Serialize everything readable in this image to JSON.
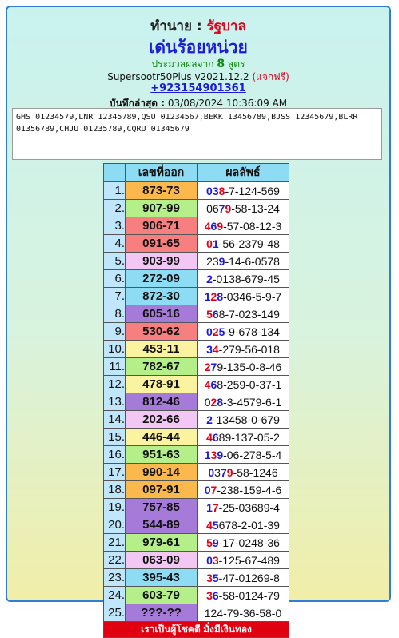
{
  "header": {
    "forecast_label": "ทำนาย :",
    "forecast_value": "รัฐบาล",
    "title": "เด่นร้อยหน่วย",
    "calc_prefix": "ประมวลผลจาก",
    "calc_count": "8",
    "calc_suffix": "สูตร",
    "version": "Supersootr50Plus v2021.12.2",
    "free_note": "(แจกฟรี)",
    "phone": "+923154901361",
    "saved_label": "บันทึกล่าสุด :",
    "saved_value": "03/08/2024 10:36:09 AM"
  },
  "notes": {
    "text": "GHS 01234579,LNR 12345789,QSU 01234567,BEKK 13456789,BJSS 12345679,BLRR 01356789,CHJU 01235789,CQRU 01345679"
  },
  "table": {
    "headers": [
      "",
      "เลขที่ออก",
      "ผลลัพธ์"
    ],
    "rows": [
      {
        "idx": "1.",
        "num": "873-73",
        "bg": "orange",
        "seg": [
          [
            "b",
            "0"
          ],
          [
            "b",
            "3"
          ],
          [
            "r",
            "8"
          ],
          [
            "n",
            "-7-124-569"
          ]
        ]
      },
      {
        "idx": "2.",
        "num": "907-99",
        "bg": "green",
        "seg": [
          [
            "n",
            "06"
          ],
          [
            "b",
            "7"
          ],
          [
            "r",
            "9"
          ],
          [
            "n",
            "-58-13-24"
          ]
        ]
      },
      {
        "idx": "3.",
        "num": "906-71",
        "bg": "red",
        "seg": [
          [
            "r",
            "4"
          ],
          [
            "b",
            "6"
          ],
          [
            "r",
            "9"
          ],
          [
            "n",
            "-57-08-12-3"
          ]
        ]
      },
      {
        "idx": "4.",
        "num": "091-65",
        "bg": "red",
        "seg": [
          [
            "r",
            "0"
          ],
          [
            "b",
            "1"
          ],
          [
            "n",
            "-56-2379-48"
          ]
        ]
      },
      {
        "idx": "5.",
        "num": "903-99",
        "bg": "pink",
        "seg": [
          [
            "n",
            "23"
          ],
          [
            "b",
            "9"
          ],
          [
            "n",
            "-14-6-0578"
          ]
        ]
      },
      {
        "idx": "6.",
        "num": "272-09",
        "bg": "cyan",
        "seg": [
          [
            "b",
            "2"
          ],
          [
            "n",
            "-0138-679-45"
          ]
        ]
      },
      {
        "idx": "7.",
        "num": "872-30",
        "bg": "cyan",
        "seg": [
          [
            "b",
            "1"
          ],
          [
            "r",
            "2"
          ],
          [
            "b",
            "8"
          ],
          [
            "n",
            "-0346-5-9-7"
          ]
        ]
      },
      {
        "idx": "8.",
        "num": "605-16",
        "bg": "purple",
        "seg": [
          [
            "r",
            "5"
          ],
          [
            "b",
            "6"
          ],
          [
            "n",
            "8-7-023-149"
          ]
        ]
      },
      {
        "idx": "9.",
        "num": "530-62",
        "bg": "red",
        "seg": [
          [
            "b",
            "0"
          ],
          [
            "r",
            "2"
          ],
          [
            "b",
            "5"
          ],
          [
            "n",
            "-9-678-134"
          ]
        ]
      },
      {
        "idx": "10.",
        "num": "453-11",
        "bg": "yellow",
        "seg": [
          [
            "b",
            "3"
          ],
          [
            "r",
            "4"
          ],
          [
            "n",
            "-279-56-018"
          ]
        ]
      },
      {
        "idx": "11.",
        "num": "782-67",
        "bg": "green",
        "seg": [
          [
            "r",
            "2"
          ],
          [
            "b",
            "7"
          ],
          [
            "n",
            "9-135-0-8-46"
          ]
        ]
      },
      {
        "idx": "12.",
        "num": "478-91",
        "bg": "yellow",
        "seg": [
          [
            "r",
            "4"
          ],
          [
            "b",
            "6"
          ],
          [
            "n",
            "8-259-0-37-1"
          ]
        ]
      },
      {
        "idx": "13.",
        "num": "812-46",
        "bg": "purple",
        "seg": [
          [
            "n",
            "0"
          ],
          [
            "r",
            "2"
          ],
          [
            "b",
            "8"
          ],
          [
            "n",
            "-3-4579-6-1"
          ]
        ]
      },
      {
        "idx": "14.",
        "num": "202-66",
        "bg": "pink",
        "seg": [
          [
            "b",
            "2"
          ],
          [
            "n",
            "-13458-0-679"
          ]
        ]
      },
      {
        "idx": "15.",
        "num": "446-44",
        "bg": "yellow",
        "seg": [
          [
            "r",
            "4"
          ],
          [
            "b",
            "6"
          ],
          [
            "n",
            "89-137-05-2"
          ]
        ]
      },
      {
        "idx": "16.",
        "num": "951-63",
        "bg": "green",
        "seg": [
          [
            "b",
            "1"
          ],
          [
            "r",
            "3"
          ],
          [
            "b",
            "9"
          ],
          [
            "n",
            "-06-278-5-4"
          ]
        ]
      },
      {
        "idx": "17.",
        "num": "990-14",
        "bg": "orange",
        "seg": [
          [
            "b",
            "0"
          ],
          [
            "n",
            "3"
          ],
          [
            "b",
            "7"
          ],
          [
            "r",
            "9"
          ],
          [
            "n",
            "-58-1246"
          ]
        ]
      },
      {
        "idx": "18.",
        "num": "097-91",
        "bg": "orange",
        "seg": [
          [
            "b",
            "0"
          ],
          [
            "r",
            "7"
          ],
          [
            "n",
            "-238-159-4-6"
          ]
        ]
      },
      {
        "idx": "19.",
        "num": "757-85",
        "bg": "purple",
        "seg": [
          [
            "b",
            "1"
          ],
          [
            "r",
            "7"
          ],
          [
            "n",
            "-25-03689-4"
          ]
        ]
      },
      {
        "idx": "20.",
        "num": "544-89",
        "bg": "purple",
        "seg": [
          [
            "r",
            "4"
          ],
          [
            "b",
            "5"
          ],
          [
            "n",
            "678-2-01-39"
          ]
        ]
      },
      {
        "idx": "21.",
        "num": "979-61",
        "bg": "green",
        "seg": [
          [
            "r",
            "5"
          ],
          [
            "b",
            "9"
          ],
          [
            "n",
            "-17-0248-36"
          ]
        ]
      },
      {
        "idx": "22.",
        "num": "063-09",
        "bg": "pink",
        "seg": [
          [
            "b",
            "0"
          ],
          [
            "r",
            "3"
          ],
          [
            "n",
            "-125-67-489"
          ]
        ]
      },
      {
        "idx": "23.",
        "num": "395-43",
        "bg": "cyan",
        "seg": [
          [
            "r",
            "3"
          ],
          [
            "b",
            "5"
          ],
          [
            "n",
            "-47-01269-8"
          ]
        ]
      },
      {
        "idx": "24.",
        "num": "603-79",
        "bg": "green",
        "seg": [
          [
            "r",
            "3"
          ],
          [
            "b",
            "6"
          ],
          [
            "n",
            "-58-0124-79"
          ]
        ]
      },
      {
        "idx": "25.",
        "num": "???-??",
        "bg": "purple",
        "seg": [
          [
            "n",
            "124-79-36-58-0"
          ]
        ]
      }
    ],
    "footer": "เราเป็นผู้โชคดี มั่งมีเงินทอง"
  },
  "colors": {
    "orange": "#fbb84c",
    "green": "#b5ef8a",
    "red": "#f77f7f",
    "pink": "#f2c7f4",
    "cyan": "#8ddcf4",
    "purple": "#a67ad8",
    "yellow": "#fbf3a0"
  }
}
